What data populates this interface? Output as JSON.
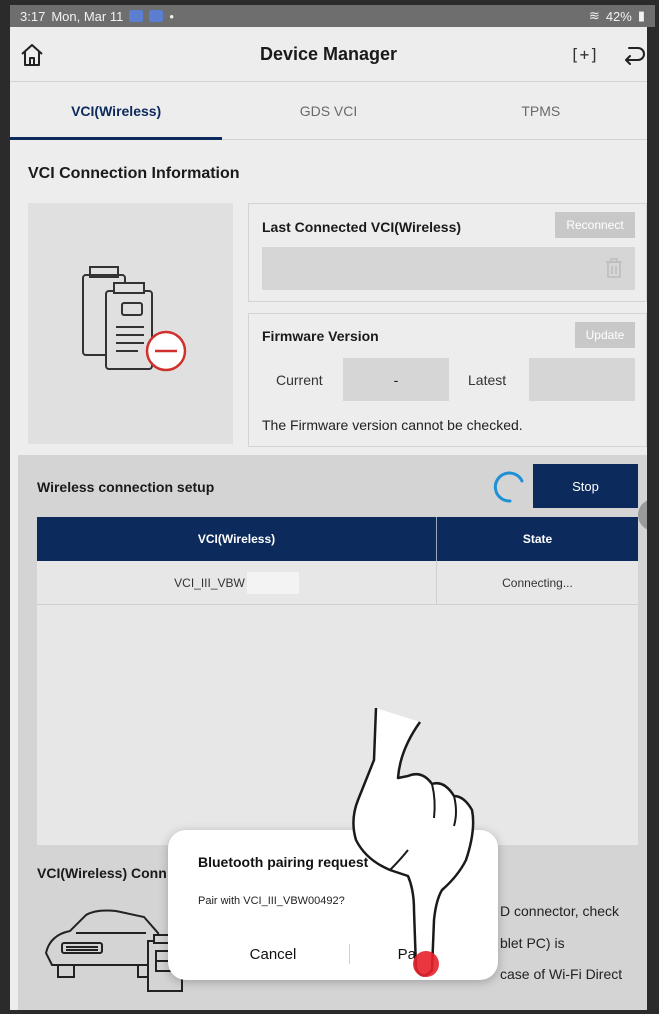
{
  "status_bar": {
    "time": "3:17",
    "date": "Mon, Mar 11",
    "battery": "42%"
  },
  "header": {
    "title": "Device Manager"
  },
  "tabs": [
    {
      "label": "VCI(Wireless)",
      "active": true
    },
    {
      "label": "GDS VCI",
      "active": false
    },
    {
      "label": "TPMS",
      "active": false
    }
  ],
  "vci_info": {
    "section_title": "VCI Connection Information",
    "last_connected_label": "Last Connected VCI(Wireless)",
    "reconnect_label": "Reconnect",
    "firmware_label": "Firmware Version",
    "update_label": "Update",
    "current_label": "Current",
    "current_value": "-",
    "latest_label": "Latest",
    "note": "The Firmware version cannot be checked."
  },
  "wireless": {
    "title": "Wireless connection setup",
    "stop_label": "Stop",
    "columns": [
      "VCI(Wireless)",
      "State"
    ],
    "rows": [
      {
        "vci": "VCI_III_VBW",
        "state": "Connecting..."
      }
    ],
    "connection_title": "VCI(Wireless) Conn",
    "bullets": [
      "D connector, check",
      "blet PC) is",
      "case of Wi-Fi Direct"
    ]
  },
  "dialog": {
    "title": "Bluetooth pairing request",
    "message": "Pair with VCI_III_VBW00492?",
    "cancel": "Cancel",
    "pair": "Pair"
  },
  "colors": {
    "navy": "#0c2a5c",
    "accent_blue": "#1e90d6",
    "alert_red": "#d0312d"
  }
}
